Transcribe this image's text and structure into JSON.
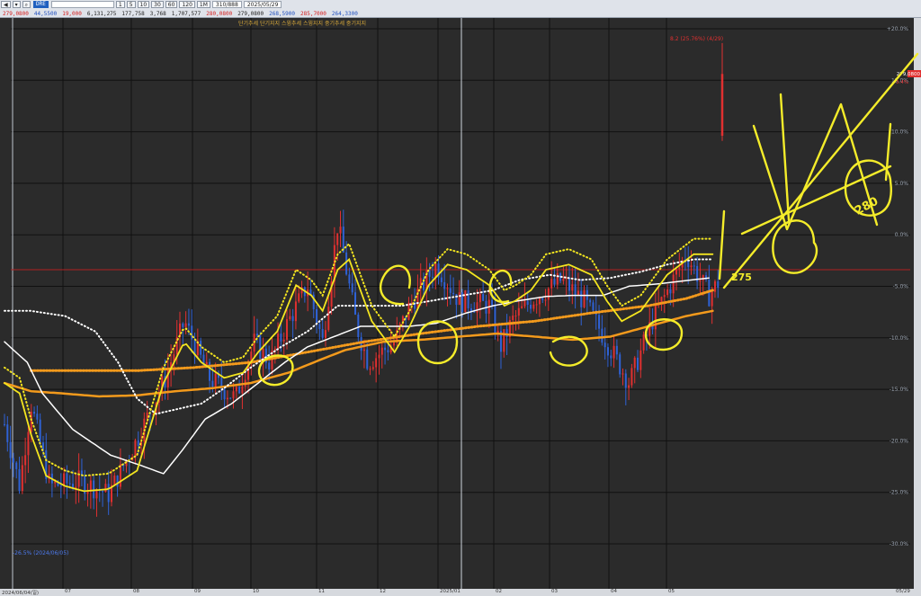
{
  "toolbar": {
    "code": "DRE",
    "interval_buttons": [
      "1",
      "5",
      "10",
      "30",
      "60",
      "120",
      "1M"
    ],
    "row1_items": [
      {
        "text": "279,0800",
        "cls": "tb-red"
      },
      {
        "text": "44,5500",
        "cls": "tb-blue"
      },
      {
        "text": "19,000",
        "cls": "tb-red"
      },
      {
        "text": "6,131,275",
        "cls": ""
      },
      {
        "text": "177,758",
        "cls": ""
      },
      {
        "text": "3,768",
        "cls": ""
      },
      {
        "text": "1,707,577",
        "cls": ""
      },
      {
        "text": "280,0800",
        "cls": "tb-red"
      },
      {
        "text": "279,0800",
        "cls": ""
      },
      {
        "text": "268,5900",
        "cls": "tb-blue"
      },
      {
        "text": "285,7000",
        "cls": "tb-red"
      },
      {
        "text": "264,3300",
        "cls": "tb-blue"
      }
    ],
    "count_field": "310/888",
    "date_field": "2025/05/29"
  },
  "legend_text": "단기추세  단기지지  스윙추세  스윙지지  중기추세  중기지지",
  "colors": {
    "background": "#2b2b2b",
    "up_candle": "#e03030",
    "down_candle": "#2f62d6",
    "short_ma": "#f3e51f",
    "swing_ma": "#ffffff",
    "mid_ma": "#f39a1c",
    "annotation": "#f4ec2a",
    "zero_line": "#b02020"
  },
  "chart_data": {
    "type": "candlestick",
    "x_labels": [
      "07",
      "08",
      "09",
      "10",
      "11",
      "12",
      "2025/01",
      "02",
      "03",
      "04",
      "05"
    ],
    "y_ticks": [
      "+20.0%",
      "15.0%",
      "10.0%",
      "5.0%",
      "0.0%",
      "-5.0%",
      "-10.0%",
      "-15.0%",
      "-20.0%",
      "-25.0%",
      "-30.0%"
    ],
    "y_range": [
      -30,
      24
    ],
    "start_label": "2024/06/04(일)",
    "end_label": "05/29",
    "low_annotation": "-26.5% (2024/06/05)",
    "high_annotation": "8.2 (25.76%) (4/29)",
    "current_price_label": "279,0800",
    "current_change_label": "-3.4%",
    "bars_count": 240,
    "anchors": [
      [
        0,
        -15.0
      ],
      [
        8,
        -21.0
      ],
      [
        14,
        -13.0
      ],
      [
        24,
        -21.0
      ],
      [
        40,
        -20.5
      ],
      [
        55,
        -21.8
      ],
      [
        70,
        -16.5
      ],
      [
        85,
        -10.5
      ],
      [
        95,
        -5.0
      ],
      [
        108,
        -10.5
      ],
      [
        122,
        -12.5
      ],
      [
        132,
        -7.0
      ],
      [
        140,
        -9.0
      ],
      [
        150,
        -5.0
      ],
      [
        160,
        -1.5
      ],
      [
        168,
        -7.0
      ],
      [
        176,
        4.5
      ],
      [
        186,
        -5.5
      ],
      [
        192,
        -9.0
      ],
      [
        206,
        -7.0
      ],
      [
        214,
        -3.5
      ],
      [
        228,
        0.5
      ],
      [
        240,
        -3.0
      ],
      [
        256,
        -3.5
      ],
      [
        262,
        -7.5
      ],
      [
        268,
        -5.0
      ],
      [
        278,
        -3.0
      ],
      [
        294,
        -1.0
      ],
      [
        306,
        -3.0
      ],
      [
        318,
        -7.0
      ],
      [
        330,
        -11.0
      ],
      [
        342,
        -5.0
      ],
      [
        360,
        1.5
      ],
      [
        372,
        -2.5
      ],
      [
        378,
        -1.0
      ]
    ],
    "short_ma_pts": [
      [
        0,
        -11
      ],
      [
        8,
        -12
      ],
      [
        14,
        -16
      ],
      [
        22,
        -20
      ],
      [
        32,
        -21
      ],
      [
        42,
        -21.5
      ],
      [
        55,
        -21.3
      ],
      [
        70,
        -19.5
      ],
      [
        84,
        -11
      ],
      [
        95,
        -7
      ],
      [
        104,
        -9
      ],
      [
        116,
        -10.5
      ],
      [
        126,
        -10.0
      ],
      [
        134,
        -8.0
      ],
      [
        144,
        -6
      ],
      [
        154,
        -1.5
      ],
      [
        162,
        -2.5
      ],
      [
        168,
        -4.0
      ],
      [
        176,
        0
      ],
      [
        182,
        1
      ],
      [
        188,
        -2
      ],
      [
        194,
        -5
      ],
      [
        206,
        -8
      ],
      [
        214,
        -5.5
      ],
      [
        224,
        -1.5
      ],
      [
        234,
        0.5
      ],
      [
        244,
        0
      ],
      [
        256,
        -1.5
      ],
      [
        264,
        -3.5
      ],
      [
        270,
        -3.0
      ],
      [
        278,
        -2.0
      ],
      [
        286,
        0
      ],
      [
        298,
        0.5
      ],
      [
        310,
        -0.5
      ],
      [
        318,
        -3.0
      ],
      [
        326,
        -5.0
      ],
      [
        336,
        -4.0
      ],
      [
        350,
        -0.5
      ],
      [
        364,
        1.5
      ],
      [
        374,
        1.5
      ]
    ],
    "swing_ma_pts": [
      [
        0,
        -7
      ],
      [
        12,
        -9
      ],
      [
        20,
        -12
      ],
      [
        36,
        -15.5
      ],
      [
        56,
        -18
      ],
      [
        72,
        -19
      ],
      [
        84,
        -19.8
      ],
      [
        94,
        -17.5
      ],
      [
        106,
        -14.5
      ],
      [
        120,
        -13
      ],
      [
        134,
        -11.0
      ],
      [
        148,
        -9.0
      ],
      [
        160,
        -7.5
      ],
      [
        174,
        -6.5
      ],
      [
        188,
        -5.5
      ],
      [
        200,
        -5.5
      ],
      [
        214,
        -5.5
      ],
      [
        228,
        -5.2
      ],
      [
        244,
        -4.2
      ],
      [
        258,
        -3.5
      ],
      [
        272,
        -3.0
      ],
      [
        286,
        -2.6
      ],
      [
        300,
        -2.5
      ],
      [
        316,
        -2.5
      ],
      [
        330,
        -1.6
      ],
      [
        344,
        -1.4
      ],
      [
        358,
        -1.1
      ],
      [
        372,
        -0.8
      ]
    ],
    "swing_dot_pts": [
      [
        0,
        -4
      ],
      [
        14,
        -4
      ],
      [
        32,
        -4.5
      ],
      [
        48,
        -6
      ],
      [
        60,
        -9
      ],
      [
        70,
        -12.5
      ],
      [
        80,
        -14
      ],
      [
        92,
        -13.5
      ],
      [
        104,
        -13
      ],
      [
        116,
        -11.5
      ],
      [
        130,
        -9.5
      ],
      [
        146,
        -7.5
      ],
      [
        160,
        -6.0
      ],
      [
        176,
        -3.5
      ],
      [
        192,
        -3.5
      ],
      [
        210,
        -3.5
      ],
      [
        226,
        -3.0
      ],
      [
        242,
        -2.5
      ],
      [
        258,
        -2.0
      ],
      [
        272,
        -1.0
      ],
      [
        288,
        -0.5
      ],
      [
        304,
        -1.0
      ],
      [
        320,
        -0.8
      ],
      [
        336,
        -0.2
      ],
      [
        350,
        0.5
      ],
      [
        364,
        1.0
      ],
      [
        374,
        1.0
      ]
    ],
    "mid_ma_pts": [
      [
        0,
        -11
      ],
      [
        14,
        -11.8
      ],
      [
        30,
        -12.0
      ],
      [
        50,
        -12.3
      ],
      [
        70,
        -12.2
      ],
      [
        90,
        -11.8
      ],
      [
        110,
        -11.5
      ],
      [
        130,
        -11.0
      ],
      [
        150,
        -10.0
      ],
      [
        166,
        -8.8
      ],
      [
        180,
        -7.8
      ],
      [
        200,
        -7.0
      ],
      [
        220,
        -6.8
      ],
      [
        240,
        -6.5
      ],
      [
        260,
        -6.2
      ],
      [
        280,
        -6.5
      ],
      [
        300,
        -6.8
      ],
      [
        320,
        -6.5
      ],
      [
        340,
        -5.5
      ],
      [
        360,
        -4.5
      ],
      [
        374,
        -4.0
      ]
    ],
    "mid_dot_pts": [
      [
        14,
        -9.8
      ],
      [
        40,
        -9.8
      ],
      [
        70,
        -9.8
      ],
      [
        100,
        -9.5
      ],
      [
        130,
        -9.0
      ],
      [
        160,
        -8.0
      ],
      [
        190,
        -7.0
      ],
      [
        220,
        -6.2
      ],
      [
        250,
        -5.5
      ],
      [
        280,
        -5.0
      ],
      [
        310,
        -4.2
      ],
      [
        340,
        -3.5
      ],
      [
        360,
        -2.8
      ],
      [
        374,
        -2.0
      ]
    ]
  },
  "drawn_labels": {
    "label1": "275",
    "label2": "280"
  }
}
